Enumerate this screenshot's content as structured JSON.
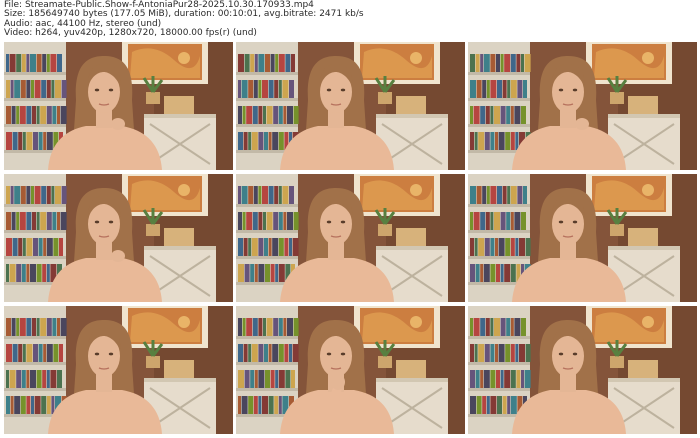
{
  "header": {
    "file": "File: Streamate-Public.Show-f-AntoniaPur28-2025.10.30.170933.mp4",
    "size": "Size: 185649740 bytes (177.05 MiB), duration: 00:10:01, avg.bitrate: 2471 kb/s",
    "audio": "Audio: aac, 44100 Hz, stereo (und)",
    "video": "Video: h264, yuv420p, 1280x720, 18000.00 fps(r) (und)"
  },
  "thumbnails": [
    {
      "pose": "hand-mouth"
    },
    {
      "pose": "neutral"
    },
    {
      "pose": "hand-mouth"
    },
    {
      "pose": "hand-mouth"
    },
    {
      "pose": "neutral"
    },
    {
      "pose": "neutral"
    },
    {
      "pose": "neutral"
    },
    {
      "pose": "hand-cheek"
    },
    {
      "pose": "neutral"
    }
  ],
  "colors": {
    "wall": "#7a4a33",
    "shelf": "#d8d4c8",
    "sweater": "#e8b89a",
    "hair": "#9a6a44",
    "skin": "#e2b596",
    "painting": "#c8783a",
    "frame": "#efe6d4",
    "dresser": "#e4ded2"
  }
}
